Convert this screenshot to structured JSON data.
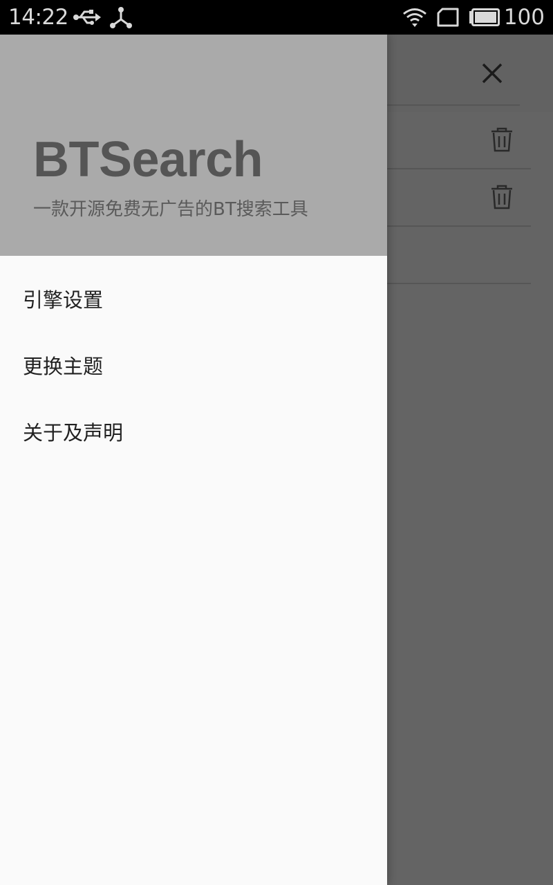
{
  "status_bar": {
    "time": "14:22",
    "battery_level": "100",
    "icons": [
      "usb-icon",
      "tether-icon",
      "wifi-icon",
      "sim-card-icon",
      "battery-icon"
    ]
  },
  "background": {
    "appbar_action_icon": "close-icon",
    "row_action_icon": "delete-icon"
  },
  "drawer": {
    "header": {
      "title": "BTSearch",
      "subtitle": "一款开源免费无广告的BT搜索工具"
    },
    "menu": [
      {
        "label": "引擎设置"
      },
      {
        "label": "更换主题"
      },
      {
        "label": "关于及声明"
      }
    ]
  },
  "colors": {
    "status_bar": "#000000",
    "drawer_header": "#aaaaaa",
    "drawer_body": "#fafafa",
    "title_text": "#555555",
    "menu_text": "#212121",
    "scrim": "#666666"
  }
}
